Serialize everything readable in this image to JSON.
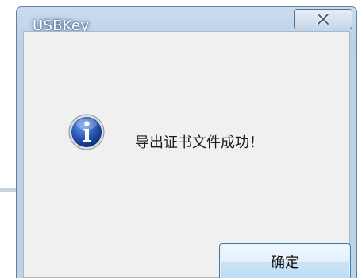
{
  "dialog": {
    "title": "USBKey",
    "close_icon": "close-x-icon",
    "icon": "information-icon",
    "message": "导出证书文件成功！",
    "ok_label": "确定"
  },
  "colors": {
    "title_text": "#ffffff",
    "titlebar": "#c9dcef",
    "client_bg": "#f0f0f0",
    "ok_border": "#3c7fb1",
    "info_icon": "#1e4f9e"
  }
}
